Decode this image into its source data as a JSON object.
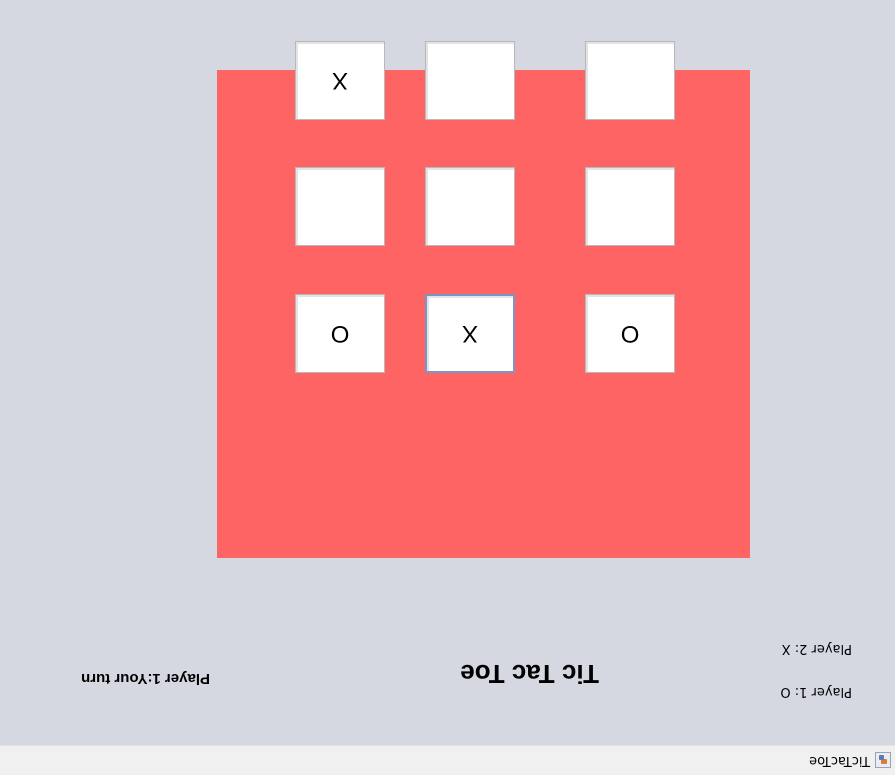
{
  "window": {
    "title": "TicTacToe",
    "icon": "java-app-icon"
  },
  "scoreboard": {
    "player1_label": "Player 1: O",
    "player2_label": "Player 2:  X"
  },
  "header": {
    "title": "Tic Tac Toe",
    "status": "Player 1:Your turn"
  },
  "board": {
    "background_color": "#ff6464",
    "cells": [
      "O",
      "X",
      "O",
      "",
      "",
      "",
      "",
      "",
      "X"
    ],
    "focused_cell": 1
  }
}
